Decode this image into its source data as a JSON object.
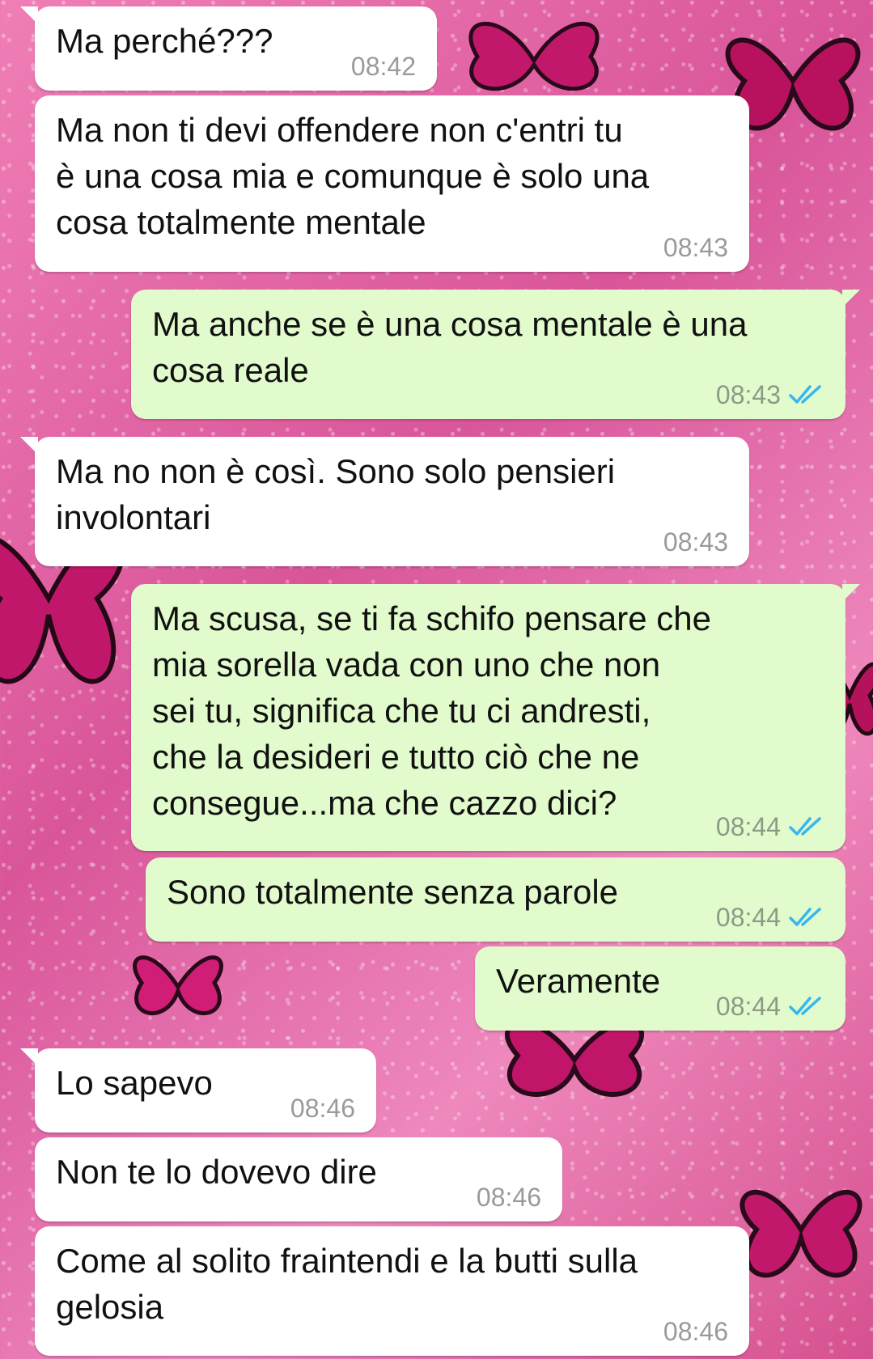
{
  "colors": {
    "incoming_bubble": "#ffffff",
    "outgoing_bubble": "#e2fbcc",
    "read_ticks": "#34b7f1",
    "wallpaper": "#e26aa6"
  },
  "messages": [
    {
      "direction": "incoming",
      "text": "Ma perché???",
      "time": "08:42"
    },
    {
      "direction": "incoming",
      "text": "Ma non ti devi offendere non c'entri tu\nè una cosa mia e comunque è solo una\ncosa totalmente mentale",
      "time": "08:43"
    },
    {
      "direction": "outgoing",
      "text": "Ma anche se è una cosa mentale è una\ncosa reale",
      "time": "08:43",
      "status_icon": "double-check-read-icon"
    },
    {
      "direction": "incoming",
      "text": "Ma no non è così. Sono solo pensieri\ninvolontari",
      "time": "08:43"
    },
    {
      "direction": "outgoing",
      "text": "Ma scusa, se ti fa schifo pensare che\nmia sorella vada con uno che non\nsei tu, significa che tu ci andresti,\nche la desideri e tutto ciò che ne\nconsegue...ma che cazzo dici?",
      "time": "08:44",
      "status_icon": "double-check-read-icon"
    },
    {
      "direction": "outgoing",
      "text": "Sono totalmente senza parole",
      "time": "08:44",
      "status_icon": "double-check-read-icon"
    },
    {
      "direction": "outgoing",
      "text": "Veramente",
      "time": "08:44",
      "status_icon": "double-check-read-icon"
    },
    {
      "direction": "incoming",
      "text": "Lo sapevo",
      "time": "08:46"
    },
    {
      "direction": "incoming",
      "text": "Non te lo dovevo dire",
      "time": "08:46"
    },
    {
      "direction": "incoming",
      "text": "Come al solito fraintendi e la butti sulla\ngelosia",
      "time": "08:46"
    }
  ]
}
